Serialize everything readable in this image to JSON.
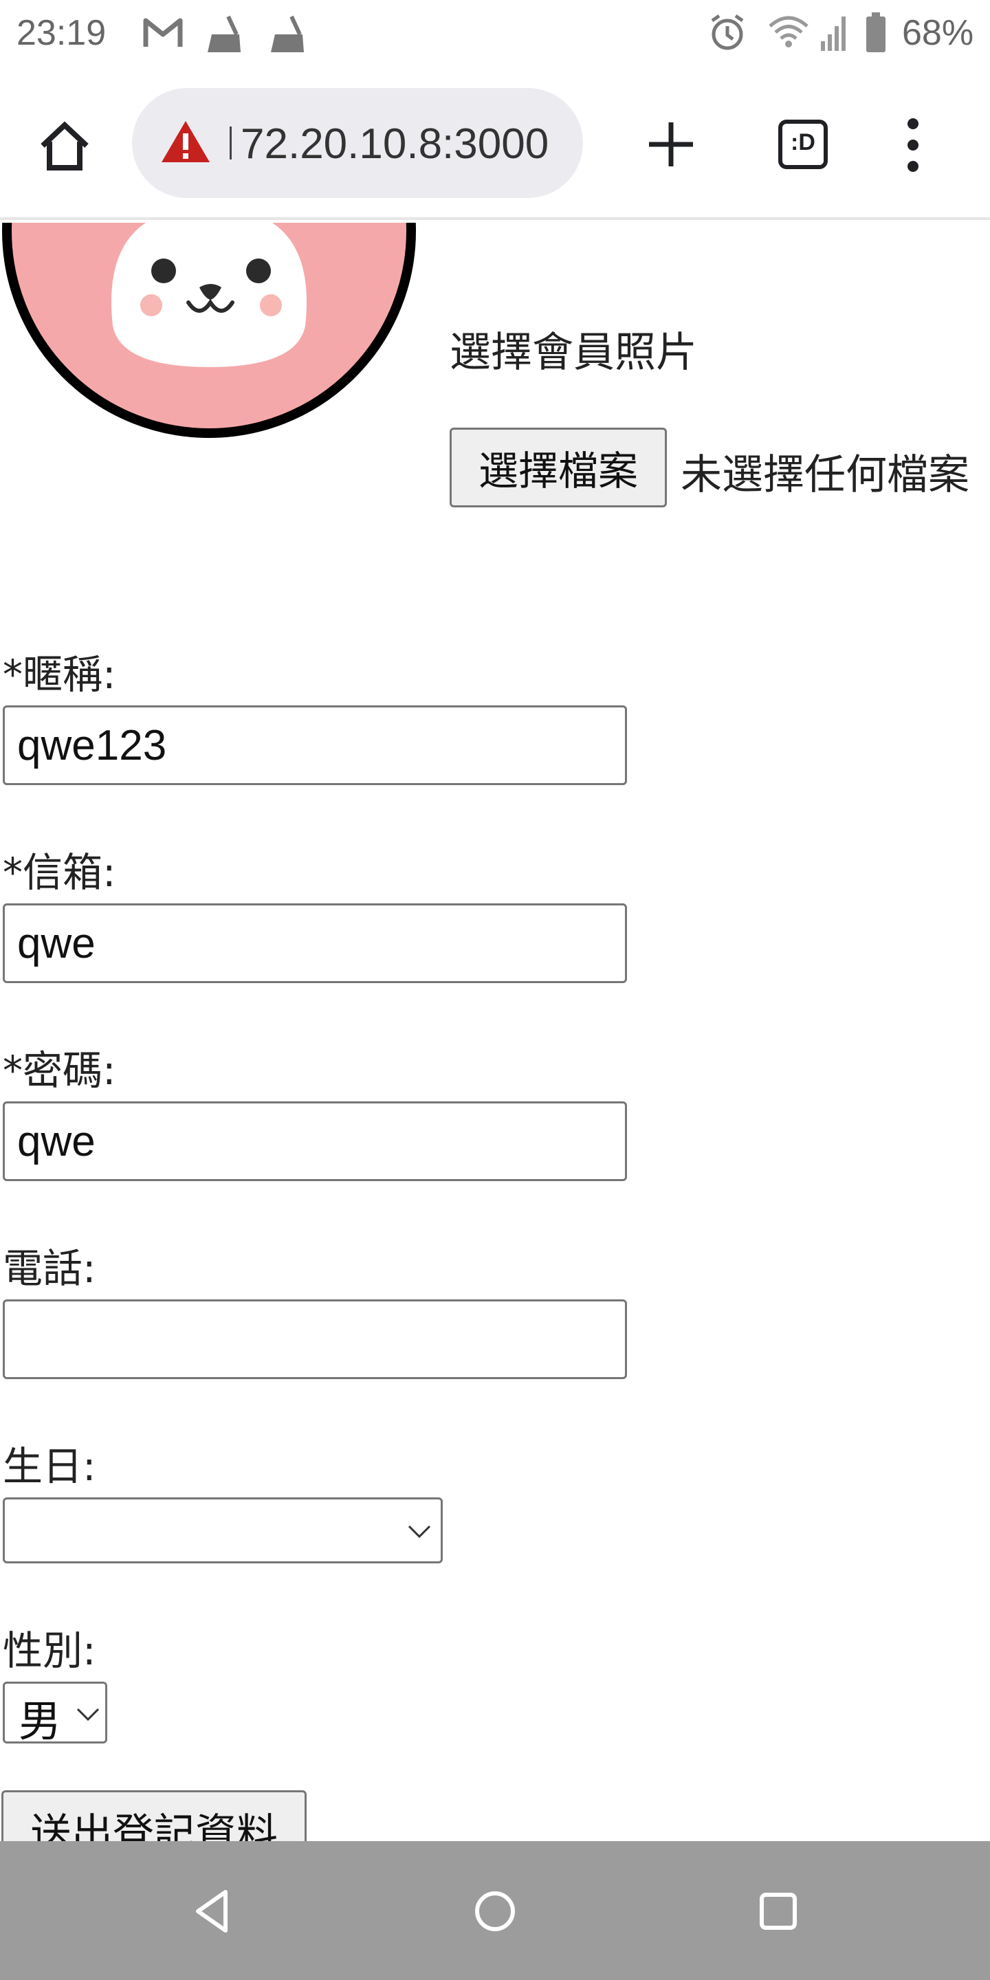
{
  "status_bar": {
    "time": "23:19",
    "battery_percent": "68%",
    "icons": [
      "gmail-icon",
      "cleaner-icon",
      "cleaner-icon",
      "alarm-icon",
      "wifi-icon",
      "signal-icon",
      "battery-icon"
    ]
  },
  "browser": {
    "url": "72.20.10.8:3000",
    "security_icon": "not-secure-warning-icon",
    "tab_switcher_label": ":D",
    "icons": [
      "home-icon",
      "new-tab-plus-icon",
      "tab-switcher-icon",
      "more-menu-icon"
    ]
  },
  "form": {
    "photo_label": "選擇會員照片",
    "file_button_label": "選擇檔案",
    "file_status": "未選擇任何檔案",
    "nickname_label": "*暱稱:",
    "nickname_value": "qwe123",
    "email_label": "*信箱:",
    "email_value": "qwe",
    "password_label": "*密碼:",
    "password_value": "qwe",
    "phone_label": "電話:",
    "phone_value": "",
    "birthday_label": "生日:",
    "birthday_value": "",
    "gender_label": "性別:",
    "gender_value": "男",
    "submit_label": "送出登記資料"
  },
  "colors": {
    "avatar_background": "#f5a8aa",
    "avatar_border": "#000000",
    "warning_red": "#c5221f",
    "nav_bar": "#8c8c8c"
  },
  "nav_bar": {
    "icons": [
      "back-icon",
      "home-circle-icon",
      "recents-icon"
    ]
  }
}
